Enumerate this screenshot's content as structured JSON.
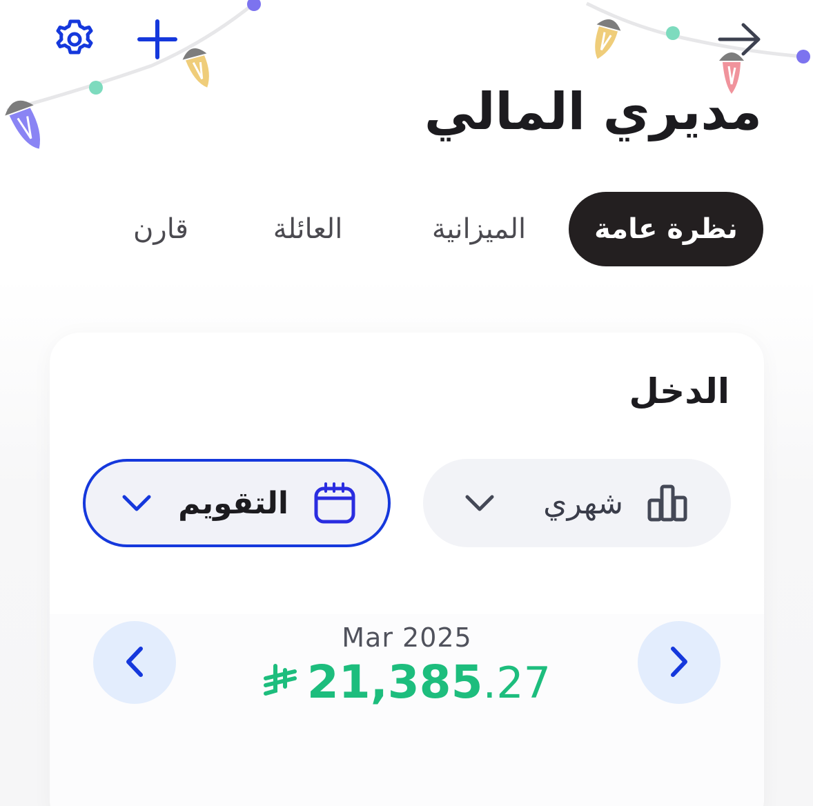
{
  "header": {
    "title": "مديري المالي",
    "icons": {
      "settings": "gear-icon",
      "add": "plus-icon",
      "forward": "arrow-right-icon"
    },
    "accent_color": "#1538dc"
  },
  "tabs": [
    {
      "label": "نظرة عامة",
      "active": true
    },
    {
      "label": "الميزانية",
      "active": false
    },
    {
      "label": "العائلة",
      "active": false
    },
    {
      "label": "قارن",
      "active": false
    }
  ],
  "income_card": {
    "title": "الدخل",
    "period_selector": {
      "value": "شهري",
      "icon": "bar-chart-icon"
    },
    "calendar_selector": {
      "value": "التقويم",
      "icon": "calendar-icon"
    },
    "month_label": "Mar 2025",
    "amount": {
      "currency_symbol": "⃁",
      "integer_part": "21,385",
      "decimal_part": ".27",
      "color": "#1dbd7d"
    }
  }
}
